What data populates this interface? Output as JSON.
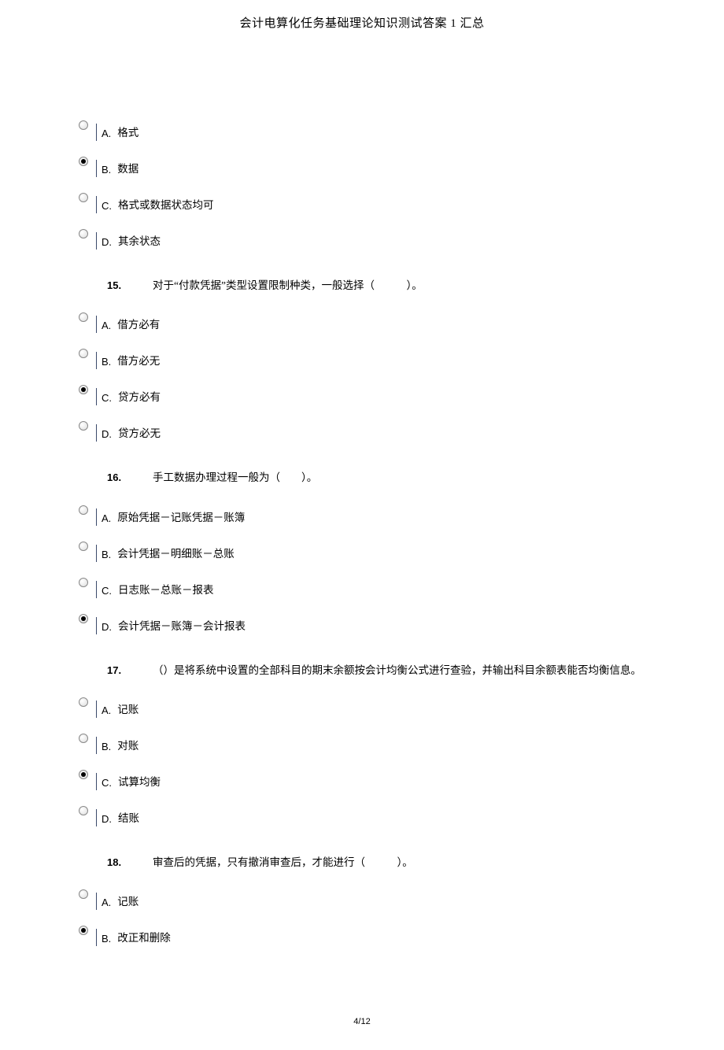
{
  "header": {
    "title": "会计电算化任务基础理论知识测试答案 1 汇总"
  },
  "questions": [
    {
      "id": "q14",
      "number": "",
      "text": "",
      "options": [
        {
          "letter": "A.",
          "text": "格式",
          "selected": false
        },
        {
          "letter": "B.",
          "text": "数据",
          "selected": true
        },
        {
          "letter": "C.",
          "text": "格式或数据状态均可",
          "selected": false
        },
        {
          "letter": "D.",
          "text": "其余状态",
          "selected": false
        }
      ]
    },
    {
      "id": "q15",
      "number": "15.",
      "text": "对于“付款凭据”类型设置限制种类，一般选择（　　　）。",
      "options": [
        {
          "letter": "A.",
          "text": "借方必有",
          "selected": false
        },
        {
          "letter": "B.",
          "text": "借方必无",
          "selected": false
        },
        {
          "letter": "C.",
          "text": "贷方必有",
          "selected": true
        },
        {
          "letter": "D.",
          "text": "贷方必无",
          "selected": false
        }
      ]
    },
    {
      "id": "q16",
      "number": "16.",
      "text": "手工数据办理过程一般为（　　）。",
      "options": [
        {
          "letter": "A.",
          "text": "原始凭据－记账凭据－账簿",
          "selected": false
        },
        {
          "letter": "B.",
          "text": "会计凭据－明细账－总账",
          "selected": false
        },
        {
          "letter": "C.",
          "text": "日志账－总账－报表",
          "selected": false
        },
        {
          "letter": "D.",
          "text": "会计凭据－账簿－会计报表",
          "selected": true
        }
      ]
    },
    {
      "id": "q17",
      "number": "17.",
      "text": "（）是将系统中设置的全部科目的期末余额按会计均衡公式进行查验，并输出科目余额表能否均衡信息。",
      "options": [
        {
          "letter": "A.",
          "text": "记账",
          "selected": false
        },
        {
          "letter": "B.",
          "text": "对账",
          "selected": false
        },
        {
          "letter": "C.",
          "text": "试算均衡",
          "selected": true
        },
        {
          "letter": "D.",
          "text": "结账",
          "selected": false
        }
      ]
    },
    {
      "id": "q18",
      "number": "18.",
      "text": "审查后的凭据，只有撤消审查后，才能进行（　　　）。",
      "options": [
        {
          "letter": "A.",
          "text": "记账",
          "selected": false
        },
        {
          "letter": "B.",
          "text": "改正和删除",
          "selected": true
        }
      ]
    }
  ],
  "footer": {
    "page": "4/12"
  }
}
